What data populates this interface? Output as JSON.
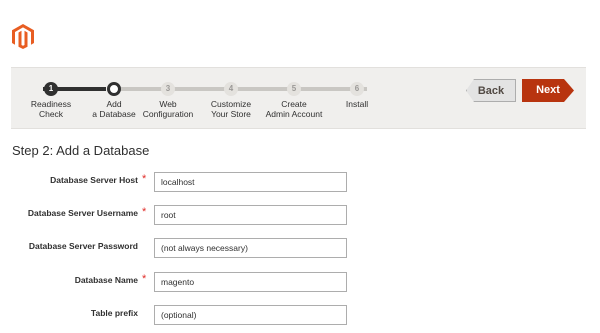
{
  "wizard": {
    "steps": [
      {
        "number": "1",
        "label": "Readiness\nCheck",
        "state": "done"
      },
      {
        "number": "2",
        "label": "Add\na Database",
        "state": "current"
      },
      {
        "number": "3",
        "label": "Web\nConfiguration",
        "state": "todo"
      },
      {
        "number": "4",
        "label": "Customize\nYour Store",
        "state": "todo"
      },
      {
        "number": "5",
        "label": "Create\nAdmin Account",
        "state": "todo"
      },
      {
        "number": "6",
        "label": "Install",
        "state": "todo"
      }
    ],
    "back_label": "Back",
    "next_label": "Next"
  },
  "page": {
    "title": "Step 2: Add a Database"
  },
  "form": {
    "fields": [
      {
        "label": "Database Server Host",
        "required": true,
        "required_mark": "*",
        "value": "localhost",
        "placeholder": ""
      },
      {
        "label": "Database Server Username",
        "required": true,
        "required_mark": "*",
        "value": "root",
        "placeholder": ""
      },
      {
        "label": "Database Server Password",
        "required": false,
        "required_mark": "",
        "value": "",
        "placeholder": "(not always necessary)"
      },
      {
        "label": "Database Name",
        "required": true,
        "required_mark": "*",
        "value": "magento",
        "placeholder": ""
      },
      {
        "label": "Table prefix",
        "required": false,
        "required_mark": "",
        "value": "",
        "placeholder": "(optional)"
      }
    ]
  },
  "colors": {
    "brand": "#b8340f",
    "required": "#e02b27",
    "progress_done": "#303030"
  }
}
